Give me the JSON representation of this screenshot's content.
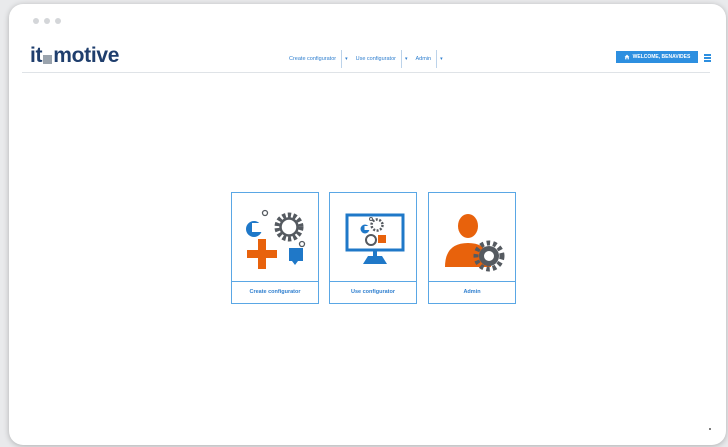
{
  "brand": {
    "logo_left": "it",
    "logo_right": "motive"
  },
  "nav": {
    "items": [
      {
        "label": "Create configurator"
      },
      {
        "label": "Use configurator"
      },
      {
        "label": "Admin"
      }
    ],
    "welcome_label": "WELCOME, BENAVIDES",
    "welcome_icon": "home-icon",
    "menu_icon": "hamburger-icon"
  },
  "cards": [
    {
      "label": "Create configurator",
      "icon": "create-configurator-icon"
    },
    {
      "label": "Use configurator",
      "icon": "use-configurator-icon"
    },
    {
      "label": "Admin",
      "icon": "admin-user-gear-icon"
    }
  ],
  "colors": {
    "accent": "#2d8fe0",
    "brand_navy": "#1f3e6d",
    "orange": "#e8620c",
    "gear_gray": "#555a60",
    "blue": "#1f78c8"
  }
}
